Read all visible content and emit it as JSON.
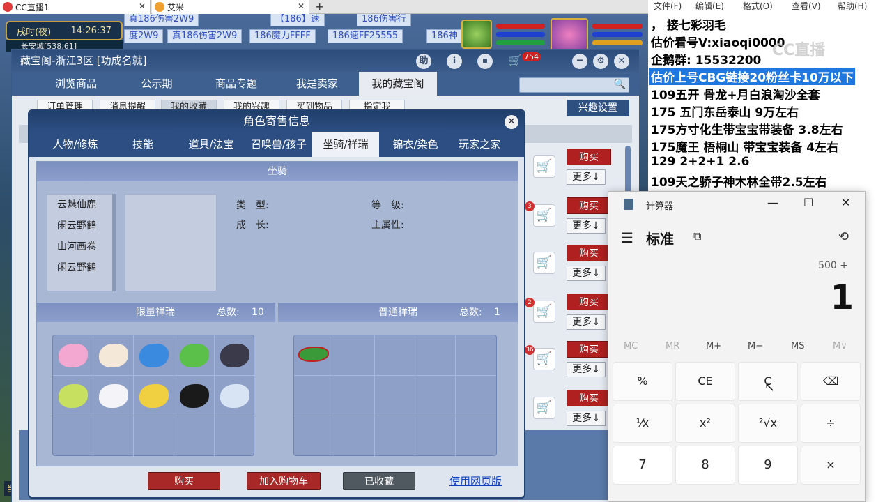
{
  "browser_tabs": [
    {
      "title": "CC直播1"
    },
    {
      "title": "艾米"
    }
  ],
  "game": {
    "time_label": "戌时(夜)",
    "time": "14:26:37",
    "location": "长安城[538,61]",
    "tickers": [
      "真186伤害2W9",
      "【186】速",
      "186伤害行",
      "度2W9",
      "真186伤害2W9",
      "186魔力FFFF",
      "186速FF25555",
      "186神"
    ],
    "bottom_text": "当前"
  },
  "panel": {
    "title": "藏宝阁-浙江3区 [功成名就]",
    "title_buttons": [
      "助",
      "ℹ",
      "⏹"
    ],
    "cart_count": "754",
    "nav_tabs": [
      "浏览商品",
      "公示期",
      "商品专题",
      "我是卖家",
      "我的藏宝阁"
    ],
    "sub_tabs": [
      "订单管理",
      "消息提醒",
      "我的收藏",
      "我的兴趣",
      "买到物品",
      "指定我"
    ],
    "interest_button": "兴趣设置",
    "row_buy_label": "购买",
    "row_more_label": "更多↓",
    "row_badges": [
      "",
      "3",
      "",
      "2",
      "36",
      ""
    ]
  },
  "dialog": {
    "title": "角色寄售信息",
    "tabs": [
      "人物/修炼",
      "技能",
      "道具/法宝",
      "召唤兽/孩子",
      "坐骑/祥瑞",
      "锦衣/染色",
      "玩家之家"
    ],
    "active_tab": "坐骑/祥瑞",
    "mount_section": "坐骑",
    "mounts": [
      "云魅仙鹿",
      "闲云野鹤",
      "山河画卷",
      "闲云野鹤"
    ],
    "fields": {
      "type_label": "类　型:",
      "level_label": "等　级:",
      "growth_label": "成　长:",
      "attr_label": "主属性:"
    },
    "limited": {
      "title": "限量祥瑞",
      "total_label": "总数:",
      "total": "10"
    },
    "normal": {
      "title": "普通祥瑞",
      "total_label": "总数:",
      "total": "1"
    },
    "buttons": {
      "buy": "购买",
      "add_cart": "加入购物车",
      "collected": "已收藏",
      "web": "使用网页版"
    }
  },
  "notepad": {
    "menu": [
      "文件(F)",
      "编辑(E)",
      "格式(O)",
      "查看(V)",
      "帮助(H)"
    ],
    "lines": [
      "，    接七彩羽毛",
      "估价看号V:xiaoqi0000",
      "企鹅群: 15532200",
      "估价上号CBG链接20粉丝卡10万以下",
      "109五开 骨龙+月白浪淘沙全套",
      "175 五门东岳泰山  9万左右",
      "175方寸化生带宝宝带装备  3.8左右",
      "175魔王 梧桐山  带宝宝装备 4左右",
      "129 2+2+1  2.6",
      "109天之骄子神木林全带2.5左右"
    ],
    "highlight_line": 3,
    "watermark": "CC直播"
  },
  "calculator": {
    "app_title": "计算器",
    "mode": "标准",
    "expression": "500 +",
    "display": "1",
    "memory": [
      "MC",
      "MR",
      "M+",
      "M−",
      "MS",
      "M∨"
    ],
    "keys": [
      [
        "%",
        "CE",
        "C",
        "⌫"
      ],
      [
        "¹⁄x",
        "x²",
        "²√x",
        "÷"
      ],
      [
        "7",
        "8",
        "9",
        "×"
      ]
    ]
  },
  "colors": {
    "nav_blue": "#3e6090",
    "buy_red": "#b02020",
    "highlight_blue": "#1e78e0"
  }
}
